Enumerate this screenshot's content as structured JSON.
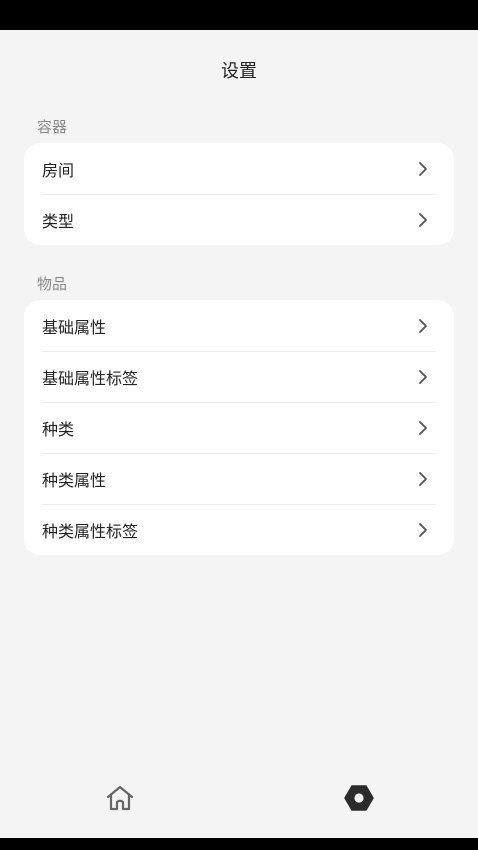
{
  "header": {
    "title": "设置"
  },
  "sections": [
    {
      "label": "容器",
      "items": [
        "房间",
        "类型"
      ]
    },
    {
      "label": "物品",
      "items": [
        "基础属性",
        "基础属性标签",
        "种类",
        "种类属性",
        "种类属性标签"
      ]
    }
  ],
  "bottom_nav": [
    {
      "icon": "home-icon"
    },
    {
      "icon": "settings-icon"
    }
  ],
  "colors": {
    "background": "#f4f4f4",
    "card": "#ffffff",
    "text": "#222222",
    "section_label": "#8a8a8a"
  }
}
